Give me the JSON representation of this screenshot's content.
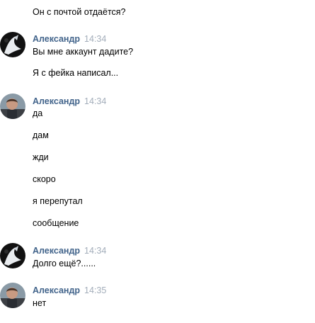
{
  "messages_prev": {
    "text": "Он с почтой отдаётся?"
  },
  "groups": [
    {
      "author": "Александр",
      "time": "14:34",
      "avatar": "dark-avatar",
      "lines": [
        "Вы мне аккаунт дадите?",
        "Я с фейка написал..."
      ]
    },
    {
      "author": "Александр",
      "time": "14:34",
      "avatar": "photo-avatar",
      "lines": [
        "да",
        "дам",
        "жди",
        "скоро",
        "я перепутал",
        "сообщение"
      ]
    },
    {
      "author": "Александр",
      "time": "14:34",
      "avatar": "dark-avatar",
      "lines": [
        "Долго ещё?......"
      ]
    },
    {
      "author": "Александр",
      "time": "14:35",
      "avatar": "photo-avatar",
      "lines": [
        "нет"
      ]
    }
  ],
  "colors": {
    "author": "#42648b",
    "time": "#a3adba",
    "text": "#000000"
  }
}
